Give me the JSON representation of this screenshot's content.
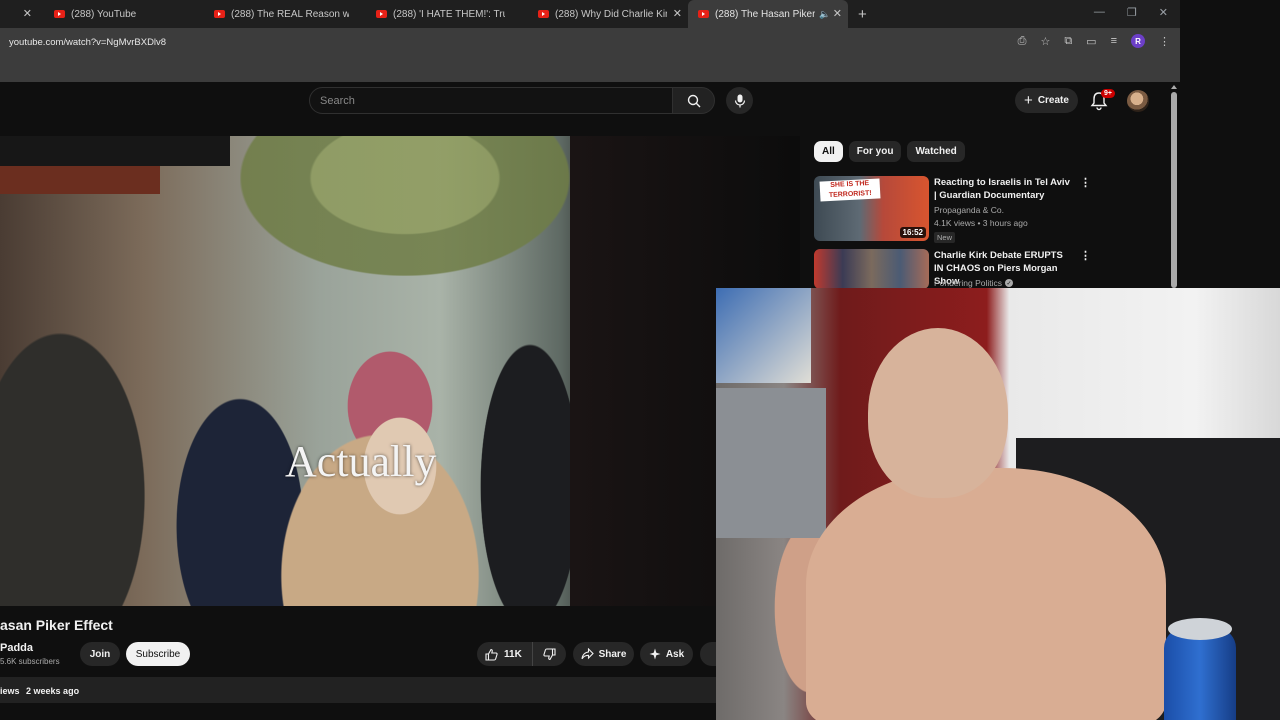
{
  "browser": {
    "tabs": [
      {
        "label": "(288) YouTube",
        "active": false
      },
      {
        "label": "(288) The REAL Reason why Hit",
        "active": false
      },
      {
        "label": "(288) 'I HATE THEM!': Trump Co",
        "active": false
      },
      {
        "label": "(288) Why Did Charlie Kirk's Me",
        "active": false
      },
      {
        "label": "(288) The Hasan Piker Effec",
        "active": true
      }
    ],
    "url": "youtube.com/watch?v=NgMvrBXDlv8",
    "profile_initial": "R"
  },
  "header": {
    "search_placeholder": "Search",
    "create_label": "Create",
    "notification_count": "9+"
  },
  "video": {
    "caption": "Actually",
    "title": "asan Piker Effect",
    "channel": "Padda",
    "subscribers": "5.6K subscribers",
    "join_label": "Join",
    "subscribe_label": "Subscribe",
    "likes": "11K",
    "share_label": "Share",
    "ask_label": "Ask",
    "views_fragment": "iews",
    "upload_date": "2 weeks ago"
  },
  "sidebar": {
    "chips": [
      {
        "label": "All",
        "active": true
      },
      {
        "label": "For you",
        "active": false
      },
      {
        "label": "Watched",
        "active": false
      }
    ],
    "recommendations": [
      {
        "title": "Reacting to Israelis in Tel Aviv | Guardian Documentary",
        "channel": "Propaganda & Co.",
        "meta": "4.1K views • 3 hours ago",
        "badge": "New",
        "duration": "16:52",
        "thumb_text": "SHE IS THE TERRORIST!"
      },
      {
        "title": "Charlie Kirk Debate ERUPTS IN CHAOS on Piers Morgan Show",
        "channel": "Pondering Politics",
        "verified": true
      }
    ]
  },
  "colors": {
    "background": "#0f0f0f",
    "chrome_tab_bar": "#1f1f1f",
    "chrome_toolbar": "#3c3c3c",
    "chip_bg": "#272727",
    "youtube_red": "#e62117"
  }
}
